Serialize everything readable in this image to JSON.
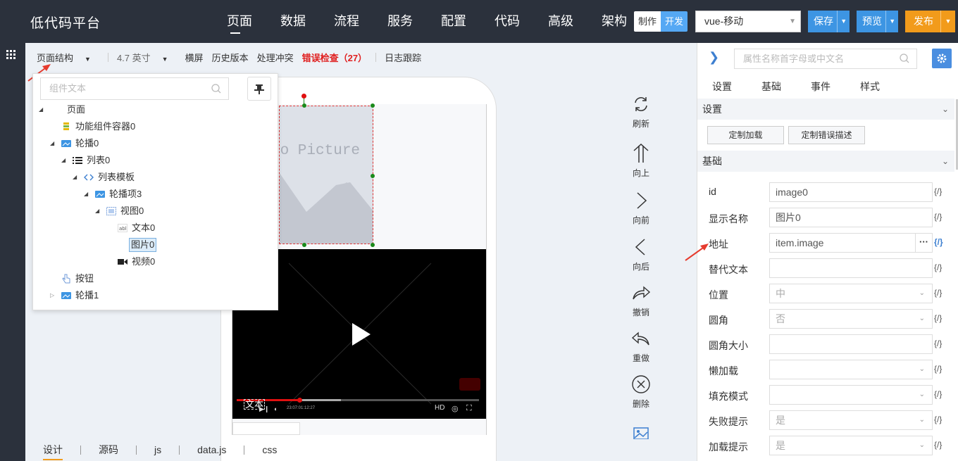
{
  "app": {
    "title": "低代码平台"
  },
  "nav": {
    "items": [
      "页面",
      "数据",
      "流程",
      "服务",
      "配置",
      "代码",
      "高级",
      "架构"
    ],
    "active": "页面"
  },
  "mode": {
    "make": "制作",
    "dev": "开发"
  },
  "device_select": {
    "value": "vue-移动"
  },
  "actions": {
    "save": "保存",
    "preview": "预览",
    "publish": "发布"
  },
  "subtoolbar": {
    "page_structure": "页面结构",
    "screen_size": "4.7 英寸",
    "landscape": "横屏",
    "history": "历史版本",
    "resolve_conflict": "处理冲突",
    "error_check": "错误检查（27）",
    "log_trace": "日志跟踪"
  },
  "tree": {
    "search_placeholder": "组件文本",
    "nodes": {
      "page": "页面",
      "func_container": "功能组件容器0",
      "carousel0": "轮播0",
      "list0": "列表0",
      "list_template": "列表模板",
      "carousel_item3": "轮播项3",
      "view0": "视图0",
      "text0": "文本0",
      "image0": "图片0",
      "video0": "视频0",
      "button": "按钮",
      "carousel1": "轮播1"
    }
  },
  "canvas": {
    "image_placeholder": "No Picture",
    "video_text_label": "文本",
    "video_time": "23:07:01:12:27",
    "video_hd": "HD",
    "video_progress": 0.26
  },
  "tools": {
    "refresh": "刷新",
    "up": "向上",
    "forward": "向前",
    "back": "向后",
    "undo": "撤销",
    "redo": "重做",
    "delete": "删除"
  },
  "bottom_tabs": {
    "items": [
      "设计",
      "源码",
      "js",
      "data.js",
      "css"
    ],
    "active": "设计"
  },
  "props": {
    "search_placeholder": "属性名称首字母或中文名",
    "tabs": [
      "设置",
      "基础",
      "事件",
      "样式"
    ],
    "section_settings": "设置",
    "btn_custom_load": "定制加载",
    "btn_custom_error": "定制错误描述",
    "section_basic": "基础",
    "bind_symbol": "{/}",
    "fields": {
      "id": {
        "label": "id",
        "value": "image0"
      },
      "display_name": {
        "label": "显示名称",
        "value": "图片0"
      },
      "src": {
        "label": "地址",
        "value": "item.image"
      },
      "alt": {
        "label": "替代文本",
        "value": ""
      },
      "position": {
        "label": "位置",
        "value": "中"
      },
      "rounded": {
        "label": "圆角",
        "value": "否"
      },
      "radius": {
        "label": "圆角大小",
        "value": ""
      },
      "lazy": {
        "label": "懒加载",
        "value": ""
      },
      "fill_mode": {
        "label": "填充模式",
        "value": ""
      },
      "fail_tip": {
        "label": "失败提示",
        "value": "是"
      },
      "load_tip": {
        "label": "加载提示",
        "value": "是"
      }
    }
  },
  "colors": {
    "topbar": "#2b313c",
    "accent_blue": "#3d95e3",
    "publish_orange": "#f29b1b",
    "error_red": "#e02020"
  }
}
